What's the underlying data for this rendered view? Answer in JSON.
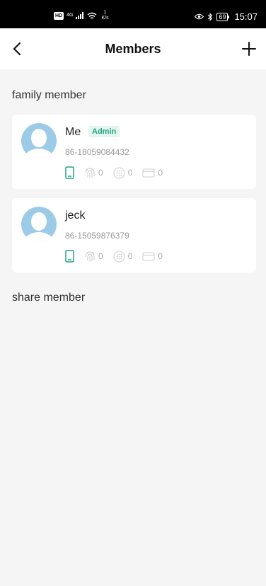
{
  "status_bar": {
    "hd": "HD",
    "network": "4G",
    "speed_value": "1",
    "speed_unit": "K/s",
    "battery": "69",
    "time": "15:07"
  },
  "header": {
    "title": "Members",
    "back_icon": "chevron-left-icon",
    "add_icon": "plus-icon"
  },
  "sections": {
    "family_title": "family member",
    "share_title": "share member"
  },
  "family_members": [
    {
      "name": "Me",
      "badge": "Admin",
      "phone": "86-18059084432",
      "fingerprint_count": "0",
      "password_count": "0",
      "card_count": "0"
    },
    {
      "name": "jeck",
      "phone": "86-15059876379",
      "fingerprint_count": "0",
      "password_count": "0",
      "card_count": "0"
    }
  ],
  "colors": {
    "accent": "#20a384",
    "avatar_bg": "#9ccbe8",
    "page_bg": "#f5f5f5"
  }
}
